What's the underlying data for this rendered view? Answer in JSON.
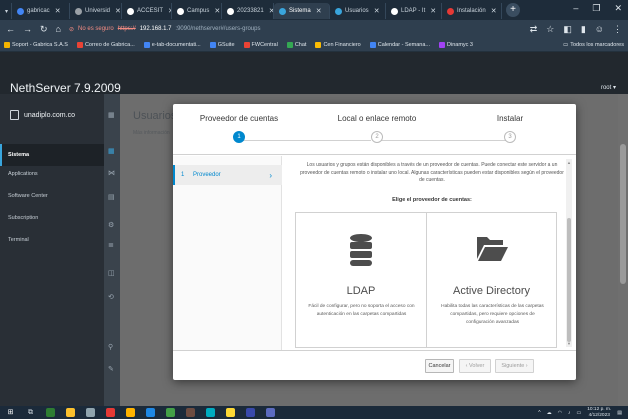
{
  "browser": {
    "tabs": [
      {
        "label": "gabricac",
        "color": "#4285f4",
        "active": false
      },
      {
        "label": "Universid",
        "color": "#9aa0a6",
        "active": false
      },
      {
        "label": "ACCESIT",
        "color": "#ffffff",
        "active": false
      },
      {
        "label": "Campus",
        "color": "#ffffff",
        "active": false
      },
      {
        "label": "20233821",
        "color": "#ffffff",
        "active": false
      },
      {
        "label": "Sistema",
        "color": "#39a5dc",
        "active": true
      },
      {
        "label": "Usuarios",
        "color": "#39a5dc",
        "active": false
      },
      {
        "label": "LDAP - It",
        "color": "#ffffff",
        "active": false
      },
      {
        "label": "Instalación",
        "color": "#e53935",
        "active": false
      }
    ],
    "insecure_label": "No es seguro",
    "url_scheme": "https://",
    "url_host": "192.168.1.7",
    "url_path": ":9090/nethserver#/users-groups",
    "bookmarks": [
      {
        "label": "Soport - Gabrica S.A.S",
        "color": "#f4b400"
      },
      {
        "label": "Correo de Gabrica...",
        "color": "#ea4335"
      },
      {
        "label": "e-tab-documentati...",
        "color": "#4285f4"
      },
      {
        "label": "GSuite",
        "color": "#4285f4"
      },
      {
        "label": "FWCentral",
        "color": "#ea4335"
      },
      {
        "label": "Chat",
        "color": "#34a853"
      },
      {
        "label": "Cen Financiero",
        "color": "#fbbc04"
      },
      {
        "label": "Calendar - Semana...",
        "color": "#4285f4"
      },
      {
        "label": "Dinamyc 3",
        "color": "#a142f4"
      }
    ],
    "all_bookmarks": "Todos los marcadores"
  },
  "app": {
    "title": "NethServer 7.9.2009",
    "user_menu": "root ▾",
    "domain": "unadiplo.com.co",
    "nav": [
      {
        "label": "Sistema",
        "active": true
      },
      {
        "label": "Applications",
        "active": false
      },
      {
        "label": "Software Center",
        "active": false
      },
      {
        "label": "Subscription",
        "active": false
      },
      {
        "label": "Terminal",
        "active": false
      }
    ],
    "page_title": "Usuarios",
    "page_subtitle": "Más información"
  },
  "wizard": {
    "steps": [
      {
        "label": "Proveedor de cuentas",
        "number": "1",
        "active": true
      },
      {
        "label": "Local o enlace remoto",
        "number": "2",
        "active": false
      },
      {
        "label": "Instalar",
        "number": "3",
        "active": false
      }
    ],
    "side_item": {
      "number": "1",
      "label": "Proveedor"
    },
    "intro": "Los usuarios y grupos están disponibles a través de un proveedor de cuentas. Puede conectar este servidor a un proveedor de cuentas remoto o instalar uno local. Algunas características pueden estar disponibles según el proveedor de cuentas.",
    "choose": "Elige el proveedor de cuentas:",
    "providers": [
      {
        "name": "LDAP",
        "desc": "Fácil de configurar, pero no soporta el acceso con autenticación en las carpetas compartidas"
      },
      {
        "name": "Active Directory",
        "desc": "Habilita todas las características de las carpetas compartidas, pero requiere opciones de configuración avanzadas"
      }
    ],
    "buttons": {
      "cancel": "Cancelar",
      "back": "‹ Volver",
      "next": "Siguiente ›"
    }
  },
  "taskbar": {
    "time": "10:12 p. m.",
    "date": "4/12/2023"
  }
}
